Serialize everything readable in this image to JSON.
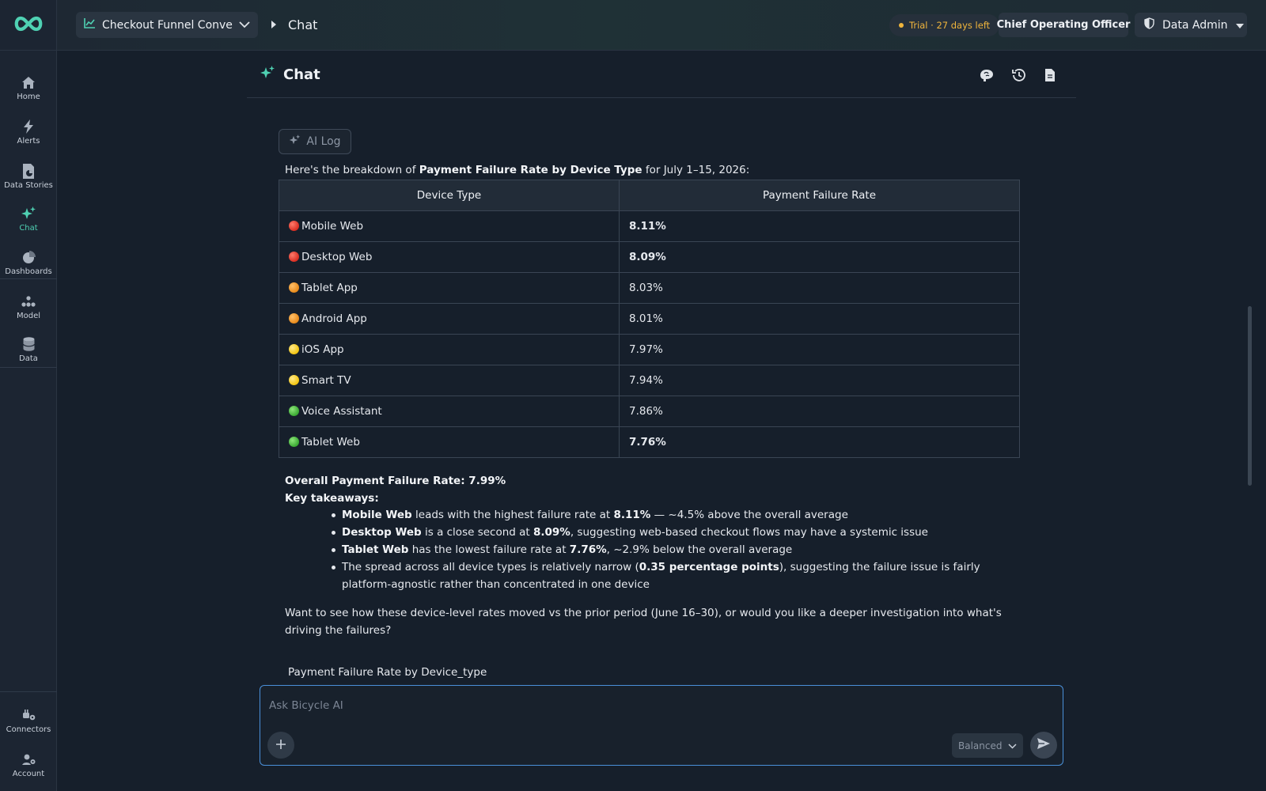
{
  "colors": {
    "accent": "#4fd1b3",
    "trial": "#f0b53c",
    "focus_border": "#4a90d9",
    "background": "#161f2b"
  },
  "sidebar": {
    "logo_icon": "infinity-logo-icon",
    "items": [
      {
        "label": "Home",
        "icon": "home-icon"
      },
      {
        "label": "Alerts",
        "icon": "lightning-icon"
      },
      {
        "label": "Data Stories",
        "icon": "document-chart-icon"
      },
      {
        "label": "Chat",
        "icon": "sparkles-icon",
        "active": true
      },
      {
        "label": "Dashboards",
        "icon": "pie-chart-icon"
      },
      {
        "label": "Model",
        "icon": "model-nodes-icon"
      },
      {
        "label": "Data",
        "icon": "database-icon"
      },
      {
        "label": "Connectors",
        "icon": "plug-icon"
      },
      {
        "label": "Account",
        "icon": "user-gear-icon"
      }
    ]
  },
  "topbar": {
    "project": "Checkout Funnel Conver...",
    "breadcrumb_current": "Chat",
    "trial": "Trial · 27 days left",
    "role": "Chief Operating Officer",
    "admin": "Data Admin"
  },
  "chat_header": {
    "title": "Chat",
    "icons": [
      "brain-icon",
      "history-icon",
      "document-icon"
    ]
  },
  "message": {
    "ai_log_label": "AI Log",
    "intro_prefix": "Here's the breakdown of ",
    "intro_bold": "Payment Failure Rate by Device Type",
    "intro_suffix": " for July 1–15, 2026:",
    "table": {
      "headers": [
        "Device Type",
        "Payment Failure Rate"
      ],
      "rows": [
        {
          "device": "Mobile Web",
          "rate": "8.11%",
          "status": "red",
          "bold": true
        },
        {
          "device": "Desktop Web",
          "rate": "8.09%",
          "status": "red",
          "bold": true
        },
        {
          "device": "Tablet App",
          "rate": "8.03%",
          "status": "orange",
          "bold": false
        },
        {
          "device": "Android App",
          "rate": "8.01%",
          "status": "orange",
          "bold": false
        },
        {
          "device": "iOS App",
          "rate": "7.97%",
          "status": "yellow",
          "bold": false
        },
        {
          "device": "Smart TV",
          "rate": "7.94%",
          "status": "yellow",
          "bold": false
        },
        {
          "device": "Voice Assistant",
          "rate": "7.86%",
          "status": "green",
          "bold": false
        },
        {
          "device": "Tablet Web",
          "rate": "7.76%",
          "status": "green",
          "bold": true
        }
      ]
    },
    "overall": "Overall Payment Failure Rate: 7.99%",
    "takeaways_title": "Key takeaways:",
    "takeaways": [
      {
        "b1": "Mobile Web",
        "t1": " leads with the highest failure rate at ",
        "b2": "8.11%",
        "t2": " — ~4.5% above the overall average"
      },
      {
        "b1": "Desktop Web",
        "t1": " is a close second at ",
        "b2": "8.09%",
        "t2": ", suggesting web-based checkout flows may have a systemic issue"
      },
      {
        "b1": "Tablet Web",
        "t1": " has the lowest failure rate at ",
        "b2": "7.76%",
        "t2": ", ~2.9% below the overall average"
      },
      {
        "b1": "",
        "t1": "The spread across all device types is relatively narrow (",
        "b2": "0.35 percentage points",
        "t2": "), suggesting the failure issue is fairly platform-agnostic rather than concentrated in one device"
      }
    ],
    "followup": "Want to see how these device-level rates moved vs the prior period (June 16–30), or would you like a deeper investigation into what's driving the failures?",
    "chart_caption": "Payment Failure Rate by Device_type"
  },
  "composer": {
    "placeholder": "Ask Bicycle AI",
    "value": "",
    "mode": "Balanced"
  }
}
